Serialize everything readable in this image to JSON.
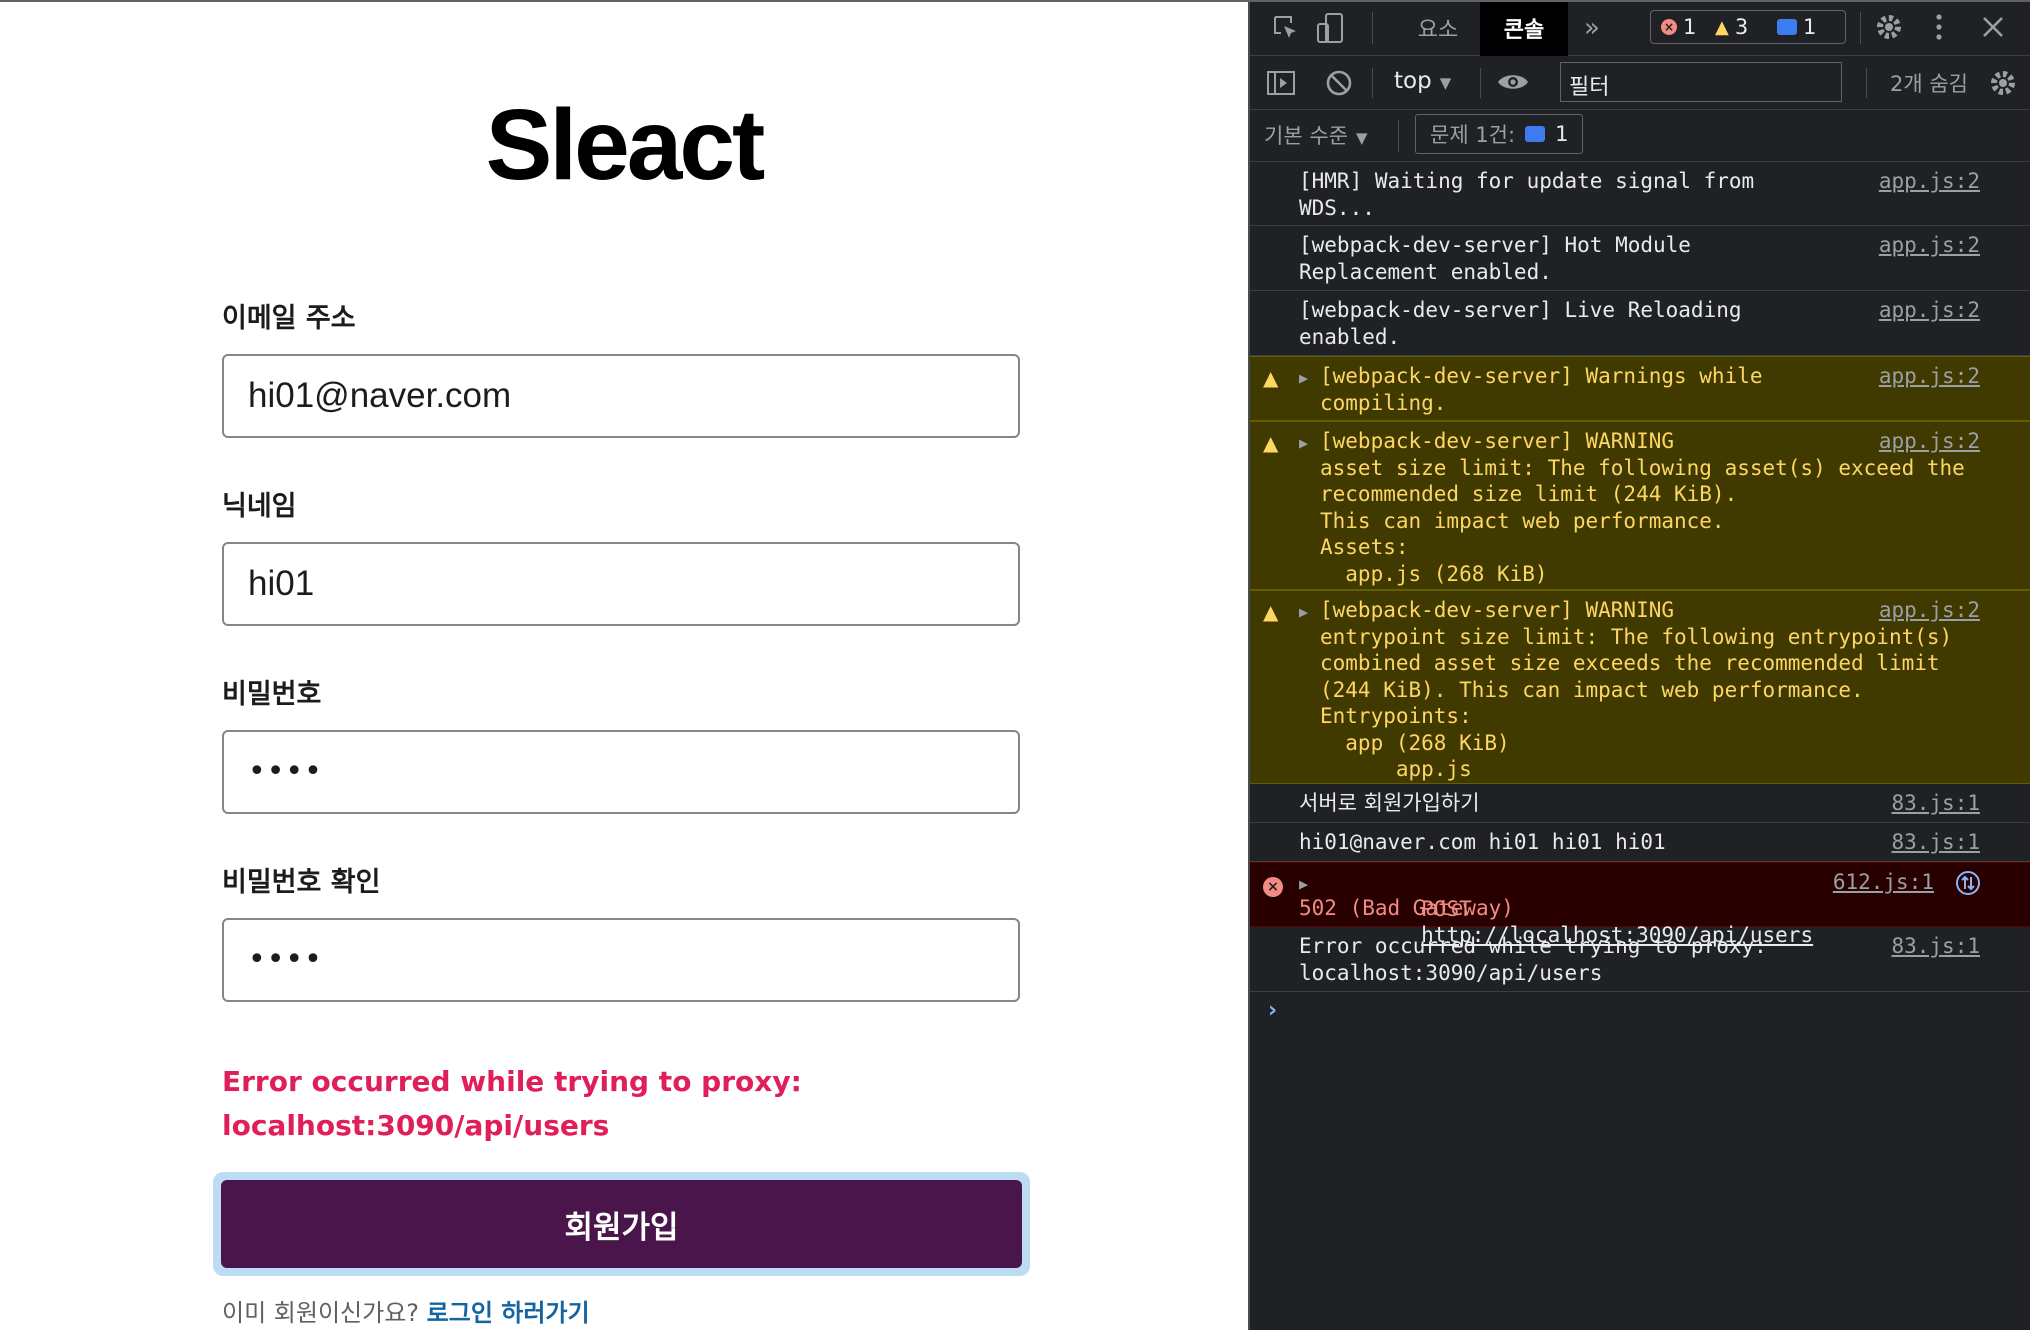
{
  "app": {
    "logo": "Sleact",
    "email_label": "이메일 주소",
    "email_value": "hi01@naver.com",
    "nickname_label": "닉네임",
    "nickname_value": "hi01",
    "password_label": "비밀번호",
    "password_value": "••••",
    "password_check_label": "비밀번호 확인",
    "password_check_value": "••••",
    "error_line1": "Error occurred while trying to proxy:",
    "error_line2": "localhost:3090/api/users",
    "submit_label": "회원가입",
    "login_prompt": "이미 회원이신가요?",
    "login_link": "로그인 하러가기"
  },
  "devtools": {
    "tabs": {
      "elements": "요소",
      "console": "콘솔",
      "more": "»"
    },
    "counts": {
      "errors": "1",
      "warnings": "3",
      "messages": "1"
    },
    "context": "top",
    "filter_placeholder": "필터",
    "hidden_count": "2개 숨김",
    "levels": "기본 수준",
    "issues_label": "문제 1건:",
    "issues_count": "1",
    "messages": [
      {
        "type": "log",
        "text": "[HMR] Waiting for update signal from\nWDS...",
        "source": "app.js:2"
      },
      {
        "type": "log",
        "text": "[webpack-dev-server] Hot Module\nReplacement enabled.",
        "source": "app.js:2"
      },
      {
        "type": "log",
        "text": "[webpack-dev-server] Live Reloading\nenabled.",
        "source": "app.js:2"
      },
      {
        "type": "warning",
        "text": "[webpack-dev-server] Warnings while\ncompiling.",
        "source": "app.js:2"
      },
      {
        "type": "warning",
        "text": "[webpack-dev-server] WARNING\nasset size limit: The following asset(s) exceed the\nrecommended size limit (244 KiB).\nThis can impact web performance.\nAssets:\n  app.js (268 KiB)",
        "source": "app.js:2"
      },
      {
        "type": "warning",
        "text": "[webpack-dev-server] WARNING\nentrypoint size limit: The following entrypoint(s)\ncombined asset size exceeds the recommended limit\n(244 KiB). This can impact web performance.\nEntrypoints:\n  app (268 KiB)\n      app.js",
        "source": "app.js:2"
      },
      {
        "type": "log",
        "text": "서버로 회원가입하기",
        "source": "83.js:1"
      },
      {
        "type": "log",
        "text": "hi01@naver.com hi01 hi01 hi01",
        "source": "83.js:1"
      },
      {
        "type": "error",
        "method": "POST",
        "url": "http://localhost:3090/api/users",
        "status": "502 (Bad Gateway)",
        "source": "612.js:1"
      },
      {
        "type": "log",
        "text": "Error occurred while trying to proxy:\nlocalhost:3090/api/users",
        "source": "83.js:1"
      }
    ],
    "prompt": "›"
  },
  "colors": {
    "brand_button": "#4a154b",
    "error_text": "#e01e5a",
    "link": "#1264a3",
    "devtools_bg": "#202124",
    "warning_bg": "#413a00",
    "error_bg": "#290000"
  }
}
